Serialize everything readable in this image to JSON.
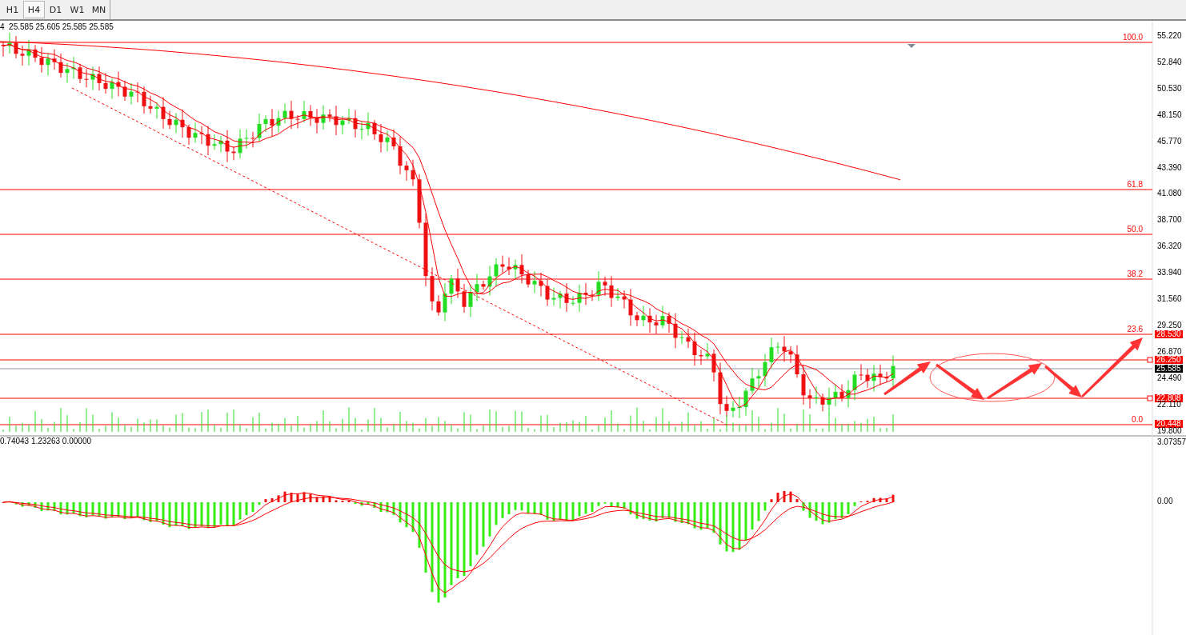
{
  "timeframe_tabs": [
    {
      "label": "H1",
      "selected": false
    },
    {
      "label": "H4",
      "selected": true
    },
    {
      "label": "D1",
      "selected": false
    },
    {
      "label": "W1",
      "selected": false
    },
    {
      "label": "MN",
      "selected": false
    }
  ],
  "price_header": "4  25.585 25.605 25.585 25.585",
  "price_axis": {
    "ticks": [
      "55.220",
      "52.840",
      "50.530",
      "48.150",
      "45.770",
      "43.390",
      "41.080",
      "38.700",
      "36.320",
      "33.940",
      "31.560",
      "29.250",
      "26.870",
      "24.490",
      "22.110",
      "19.800"
    ]
  },
  "fibonacci_levels": [
    {
      "label": "100.0"
    },
    {
      "label": "61.8"
    },
    {
      "label": "50.0"
    },
    {
      "label": "38.2"
    },
    {
      "label": "23.6"
    },
    {
      "label": "0.0"
    }
  ],
  "price_markers": [
    {
      "label": "28.530",
      "kind": "level"
    },
    {
      "label": "26.250",
      "kind": "level"
    },
    {
      "label": "25.585",
      "kind": "current"
    },
    {
      "label": "22.808",
      "kind": "level"
    },
    {
      "label": "20.448",
      "kind": "level"
    }
  ],
  "indicator": {
    "header": "0.74043 1.23263 0.00000",
    "scale_ticks": [
      "3.07357",
      "0.00"
    ]
  }
}
